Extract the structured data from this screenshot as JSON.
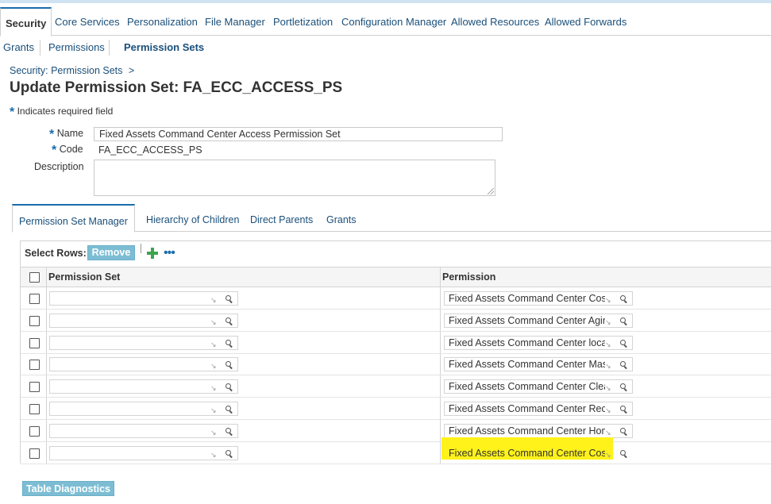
{
  "main_tabs": [
    "Security",
    "Core Services",
    "Personalization",
    "File Manager",
    "Portletization",
    "Configuration Manager",
    "Allowed Resources",
    "Allowed Forwards"
  ],
  "sub_tabs": [
    "Grants",
    "Permissions",
    "Permission Sets"
  ],
  "breadcrumb": "Security: Permission Sets",
  "breadcrumb_sep": ">",
  "page_title": "Update Permission Set: FA_ECC_ACCESS_PS",
  "required_note": "Indicates required field",
  "required_star": "*",
  "form": {
    "name_label": "Name",
    "name_value": "Fixed Assets Command Center Access Permission Set",
    "code_label": "Code",
    "code_value": "FA_ECC_ACCESS_PS",
    "description_label": "Description",
    "description_value": ""
  },
  "lower_tabs": [
    "Permission Set Manager",
    "Hierarchy of Children",
    "Direct Parents",
    "Grants"
  ],
  "table": {
    "select_rows_label": "Select Rows:",
    "remove_label": "Remove",
    "more_label": "•••",
    "headers": [
      "Permission Set",
      "Permission"
    ],
    "rows": [
      {
        "permission_set": "",
        "permission": "Fixed Assets Command Center Cost"
      },
      {
        "permission_set": "",
        "permission": "Fixed Assets Command Center Aging"
      },
      {
        "permission_set": "",
        "permission": "Fixed Assets Command Center location"
      },
      {
        "permission_set": "",
        "permission": "Fixed Assets Command Center Mass Transfer"
      },
      {
        "permission_set": "",
        "permission": "Fixed Assets Command Center Clearing"
      },
      {
        "permission_set": "",
        "permission": "Fixed Assets Command Center Reconciliation"
      },
      {
        "permission_set": "",
        "permission": "Fixed Assets Command Center Home"
      },
      {
        "permission_set": "",
        "permission": "Fixed Assets Command Center Cost"
      }
    ],
    "highlighted_row_index": 7
  },
  "table_diagnostics_label": "Table Diagnostics",
  "colors": {
    "link": "#1a4f7a",
    "accent_button": "#7cbdd4",
    "highlight": "#fff21a",
    "tab_accent": "#1a6dab"
  },
  "icons": {
    "add": "plus-icon",
    "more": "more-icon",
    "lov_search": "magnifier-icon",
    "lov_arrow": "arrow-icon"
  }
}
